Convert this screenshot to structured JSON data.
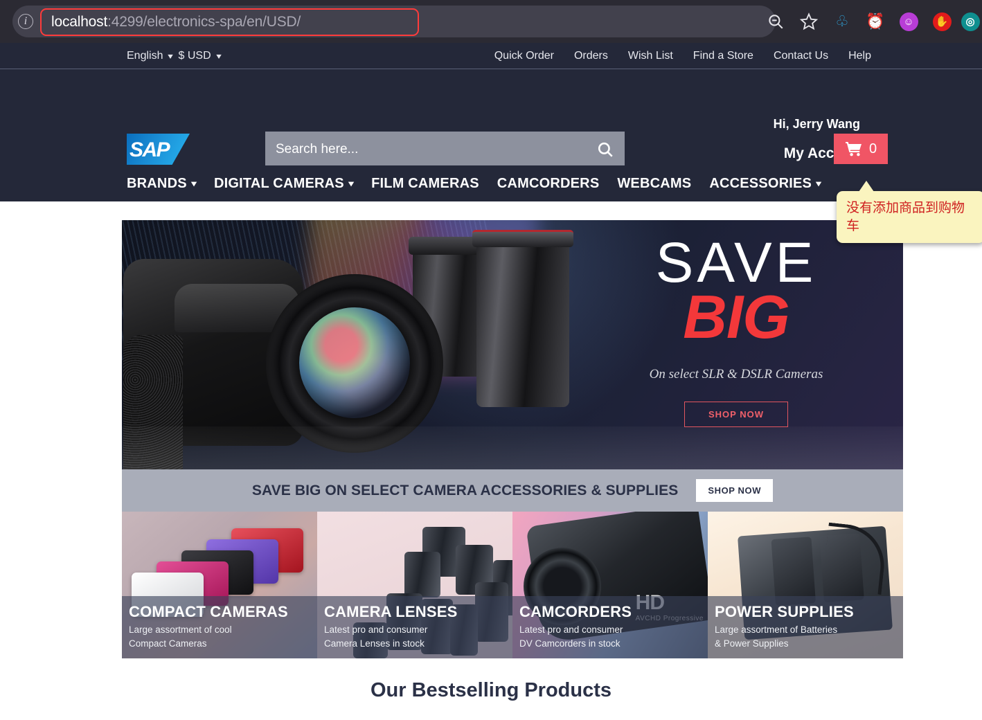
{
  "browser": {
    "url_host": "localhost",
    "url_path": ":4299/electronics-spa/en/USD/",
    "info_icon": "info-icon",
    "zoom_out_icon": "zoom-out-icon",
    "bookmark_icon": "star-icon",
    "extensions": [
      {
        "name": "extension-pin-icon",
        "glyph": "📌",
        "color": "#2e9fd4"
      },
      {
        "name": "alarm-clock-icon",
        "glyph": "⏰",
        "color": "#f3c54a"
      },
      {
        "name": "purple-badge-icon",
        "glyph": "😶",
        "color": "#b83dd6"
      },
      {
        "name": "stop-hand-icon",
        "glyph": "✋",
        "color": "#e21b1b"
      },
      {
        "name": "teal-circle-icon",
        "glyph": "◉",
        "color": "#0f8f8f"
      }
    ]
  },
  "topbar": {
    "language": "English",
    "currency": "$ USD",
    "links": [
      "Quick Order",
      "Orders",
      "Wish List",
      "Find a Store",
      "Contact Us",
      "Help"
    ]
  },
  "header": {
    "logo_text": "SAP",
    "search_placeholder": "Search here...",
    "search_value": "",
    "search_icon": "search-icon",
    "greeting": "Hi, Jerry Wang",
    "my_account": "My Account",
    "cart_icon": "shopping-cart-icon",
    "cart_count": "0",
    "cart_color": "#f05565",
    "tooltip_text": "没有添加商品到购物车",
    "tooltip_color": "#cf2020",
    "tooltip_bg": "#faf4bf"
  },
  "mainnav": {
    "items": [
      {
        "label": "BRANDS",
        "has_caret": true
      },
      {
        "label": "DIGITAL CAMERAS",
        "has_caret": true
      },
      {
        "label": "FILM CAMERAS",
        "has_caret": false
      },
      {
        "label": "CAMCORDERS",
        "has_caret": false
      },
      {
        "label": "WEBCAMS",
        "has_caret": false
      },
      {
        "label": "ACCESSORIES",
        "has_caret": true
      }
    ]
  },
  "hero": {
    "line1": "SAVE",
    "line2": "BIG",
    "subtitle": "On select SLR & DSLR Cameras",
    "cta": "SHOP NOW",
    "accent_color": "#f3383a"
  },
  "promo": {
    "text": "SAVE BIG ON SELECT CAMERA ACCESSORIES & SUPPLIES",
    "button": "SHOP NOW",
    "bg_color": "#a9adb9"
  },
  "tiles": [
    {
      "title": "COMPACT CAMERAS",
      "subtitle": "Large assortment of cool\nCompact Cameras"
    },
    {
      "title": "CAMERA LENSES",
      "subtitle": "Latest pro and consumer\nCamera Lenses in stock"
    },
    {
      "title": "CAMCORDERS",
      "subtitle": "Latest pro and consumer\nDV Camcorders in stock",
      "badge": "HD",
      "badge_sub": "AVCHD Progressive"
    },
    {
      "title": "POWER SUPPLIES",
      "subtitle": "Large assortment of Batteries\n& Power Supplies"
    }
  ],
  "section": {
    "bestselling_title": "Our Bestselling Products"
  }
}
